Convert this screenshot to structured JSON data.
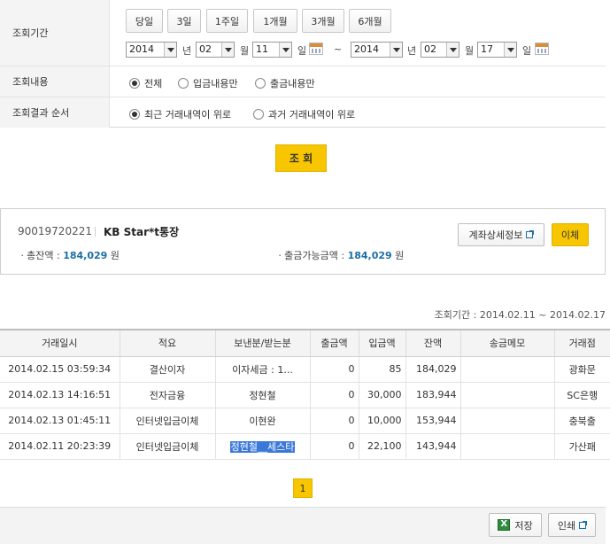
{
  "form": {
    "period_label": "조회기간",
    "quick_buttons": [
      "당일",
      "3일",
      "1주일",
      "1개월",
      "3개월",
      "6개월"
    ],
    "from": {
      "year": "2014",
      "month": "02",
      "day": "11"
    },
    "to": {
      "year": "2014",
      "month": "02",
      "day": "17"
    },
    "unit_year": "년",
    "unit_month": "월",
    "unit_day": "일",
    "tilde": "~",
    "content_label": "조회내용",
    "content_options": [
      "전체",
      "입금내용만",
      "출금내용만"
    ],
    "order_label": "조회결과 순서",
    "order_options": [
      "최근 거래내역이 위로",
      "과거 거래내역이 위로"
    ],
    "search_label": "조 회"
  },
  "account": {
    "number": "90019720221",
    "name": "KB Star*t통장",
    "total_label": "총잔액 :",
    "total_value": "184,029",
    "avail_label": "출금가능금액 :",
    "avail_value": "184,029",
    "currency": "원",
    "detail_button": "계좌상세정보",
    "transfer_button": "이체"
  },
  "period_text": "조회기간 : 2014.02.11 ~ 2014.02.17",
  "table": {
    "headers": [
      "거래일시",
      "적요",
      "보낸분/받는분",
      "출금액",
      "입금액",
      "잔액",
      "송금메모",
      "거래점"
    ],
    "rows": [
      {
        "date": "2014.02.15 03:59:34",
        "desc": "결산이자",
        "party": "이자세금 : 1...",
        "out": "0",
        "in": "85",
        "bal": "184,029",
        "memo": "",
        "branch": "광화문"
      },
      {
        "date": "2014.02.13 14:16:51",
        "desc": "전자금융",
        "party": "정현철",
        "out": "0",
        "in": "30,000",
        "bal": "183,944",
        "memo": "",
        "branch": "SC은행"
      },
      {
        "date": "2014.02.13 01:45:11",
        "desc": "인터넷입금이체",
        "party": "이현완",
        "out": "0",
        "in": "10,000",
        "bal": "153,944",
        "memo": "",
        "branch": "충북출"
      },
      {
        "date": "2014.02.11 20:23:39",
        "desc": "인터넷입금이체",
        "party": "정현철__세스타",
        "out": "0",
        "in": "22,100",
        "bal": "143,944",
        "memo": "",
        "branch": "가산패"
      }
    ]
  },
  "pagination": {
    "current": "1"
  },
  "footer": {
    "save_button": "저장",
    "print_button": "인쇄"
  }
}
